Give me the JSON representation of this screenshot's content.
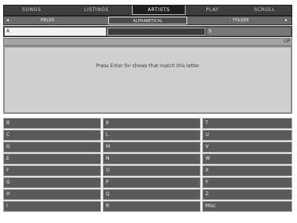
{
  "top_tabs": [
    "SONGS",
    "LISTINGS",
    "ARTISTS",
    "PLAY",
    "SCROLL"
  ],
  "top_tab_selected": 2,
  "sub_tabs": [
    "FIELDS",
    "ALPHABETICAL",
    "FOLDER"
  ],
  "sub_tab_selected": 1,
  "arrows": {
    "left": "◂",
    "right": "▸"
  },
  "fields": {
    "selected": "A",
    "right": "S"
  },
  "info": {
    "header_icon": "UP",
    "message": "Press Enter for shows that match this letter"
  },
  "grid": [
    [
      "B",
      "K",
      "T"
    ],
    [
      "C",
      "L",
      "U"
    ],
    [
      "D",
      "M",
      "V"
    ],
    [
      "E",
      "N",
      "W"
    ],
    [
      "F",
      "O",
      "X"
    ],
    [
      "G",
      "P",
      "Y"
    ],
    [
      "H",
      "Q",
      "Z"
    ],
    [
      "I",
      "R",
      "Misc"
    ]
  ],
  "colors": {
    "background": "#ffffff",
    "dark_tab": "#3e3e3e",
    "cell": "#5a5a5a",
    "panel": "#cfcfcf"
  }
}
